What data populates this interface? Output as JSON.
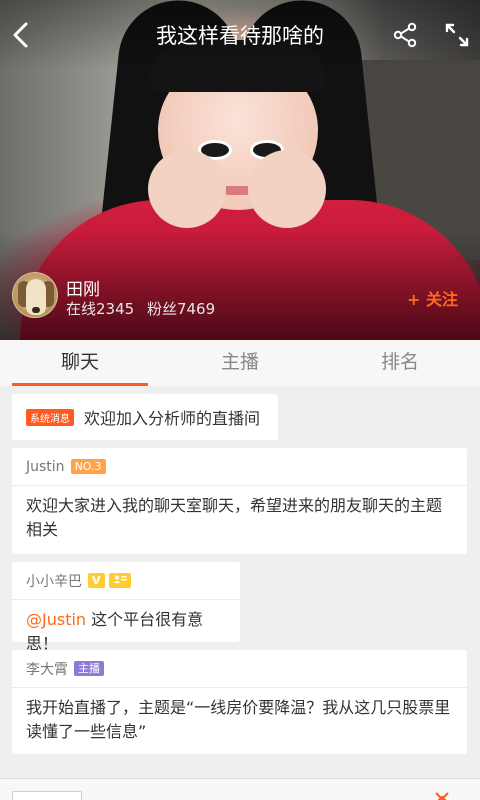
{
  "header": {
    "title": "我这样看待那啥的",
    "icons": [
      "back-icon",
      "share-icon",
      "fullscreen-icon"
    ]
  },
  "anchor": {
    "name": "田刚",
    "online_label": "在线2345",
    "fans_label": "粉丝7469",
    "follow_label": "+ 关注"
  },
  "tabs": [
    {
      "label": "聊天",
      "active": true
    },
    {
      "label": "主播",
      "active": false
    },
    {
      "label": "排名",
      "active": false
    }
  ],
  "chat": {
    "system": {
      "badge": "系统消息",
      "text": "欢迎加入分析师的直播间"
    },
    "messages": [
      {
        "user": "Justin",
        "badge": "NO.3",
        "text": "欢迎大家进入我的聊天室聊天，希望进来的朋友聊天的主题相关"
      },
      {
        "user": "小小辛巴",
        "badge": "V",
        "mention": "@Justin",
        "text": " 这个平台很有意思！"
      },
      {
        "user": "李大霄",
        "badge": "主播",
        "text": "我开始直播了，主题是“一线房价要降温？我从这几只股票里读懂了一些信息”"
      }
    ]
  },
  "colors": {
    "accent": "#ff5a1f",
    "host_badge": "#8f79d6",
    "level_badge": "#ffa24a",
    "vip_badge": "#ffcc33"
  }
}
